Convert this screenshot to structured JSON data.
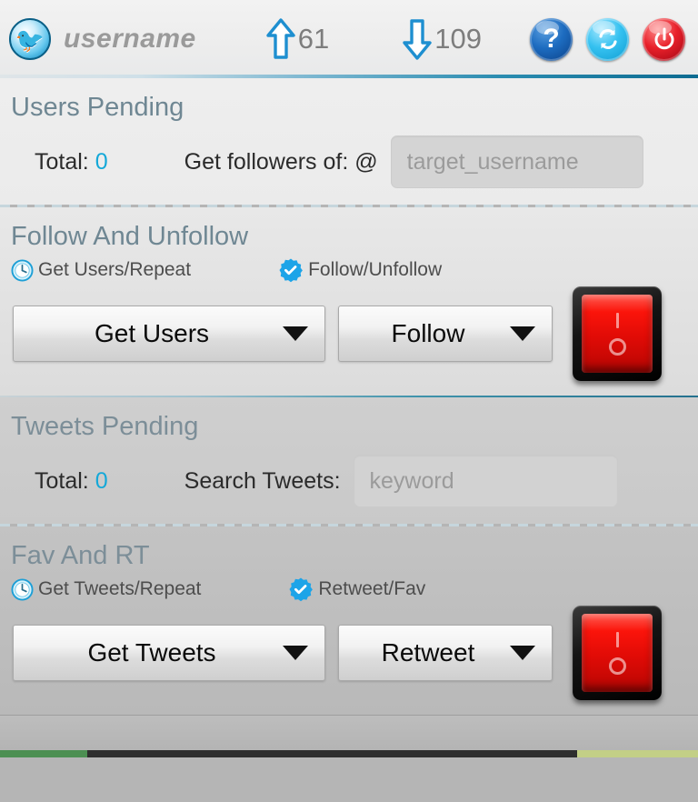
{
  "header": {
    "logo_icon": "twitter-bird-icon",
    "username": "username",
    "following": {
      "icon": "arrow-up-icon",
      "count": "61"
    },
    "followers": {
      "icon": "arrow-down-icon",
      "count": "109"
    },
    "buttons": [
      {
        "name": "help-button",
        "icon": "question-mark-icon",
        "glyph": "?",
        "color": "#1d6cc0"
      },
      {
        "name": "refresh-button",
        "icon": "refresh-icon",
        "color": "#35c1f0"
      },
      {
        "name": "power-button",
        "icon": "power-icon",
        "color": "#e8202a"
      }
    ]
  },
  "users_pending": {
    "title": "Users Pending",
    "total_label": "Total:",
    "total_value": "0",
    "field_label": "Get followers of: @",
    "input_placeholder": "target_username",
    "input_value": ""
  },
  "follow_unfollow": {
    "title": "Follow And Unfollow",
    "left_label": "Get Users/Repeat",
    "left_icon": "clock-icon",
    "right_label": "Follow/Unfollow",
    "right_icon": "verified-badge-icon",
    "left_select": "Get Users",
    "right_select": "Follow",
    "switch_state": "off",
    "switch_on_mark": "I",
    "switch_off_mark": "O"
  },
  "tweets_pending": {
    "title": "Tweets Pending",
    "total_label": "Total:",
    "total_value": "0",
    "field_label": "Search Tweets:",
    "input_placeholder": "keyword",
    "input_value": ""
  },
  "fav_rt": {
    "title": "Fav And RT",
    "left_label": "Get Tweets/Repeat",
    "left_icon": "clock-icon",
    "right_label": "Retweet/Fav",
    "right_icon": "verified-badge-icon",
    "left_select": "Get Tweets",
    "right_select": "Retweet",
    "switch_state": "off",
    "switch_on_mark": "I",
    "switch_off_mark": "O"
  },
  "colors": {
    "accent_cyan": "#14a8d8",
    "section_title": "#6f8793",
    "switch_red": "#e00b06",
    "divider_blue": "#24718e"
  }
}
